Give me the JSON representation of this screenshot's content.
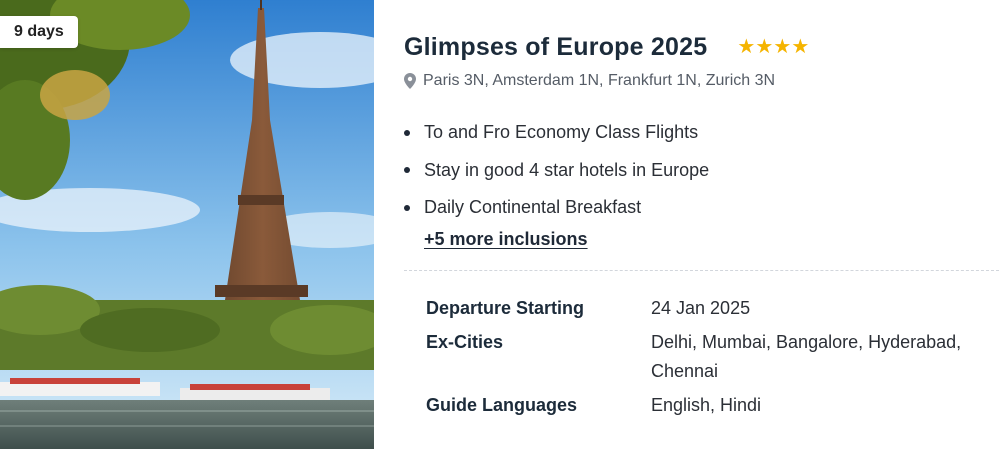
{
  "package": {
    "duration_badge": "9 days",
    "title": "Glimpses of Europe 2025",
    "hotel_rating": 4,
    "star_color": "#f5b400",
    "location_icon": "map-pin-icon",
    "cities": "Paris 3N, Amsterdam 1N, Frankfurt 1N, Zurich 3N",
    "inclusions": [
      "To and Fro Economy Class Flights",
      "Stay in good 4 star hotels in Europe",
      "Daily Continental Breakfast"
    ],
    "more_inclusions_link": "+5 more inclusions"
  },
  "info": {
    "departure_label": "Departure Starting",
    "departure_value": "24 Jan 2025",
    "excities_label": "Ex-Cities",
    "excities_value_line1": "Delhi, Mumbai, Bangalore, Hyderabad,",
    "excities_value_line2": "Chennai",
    "languages_label": "Guide Languages",
    "languages_value": "English, Hindi"
  }
}
